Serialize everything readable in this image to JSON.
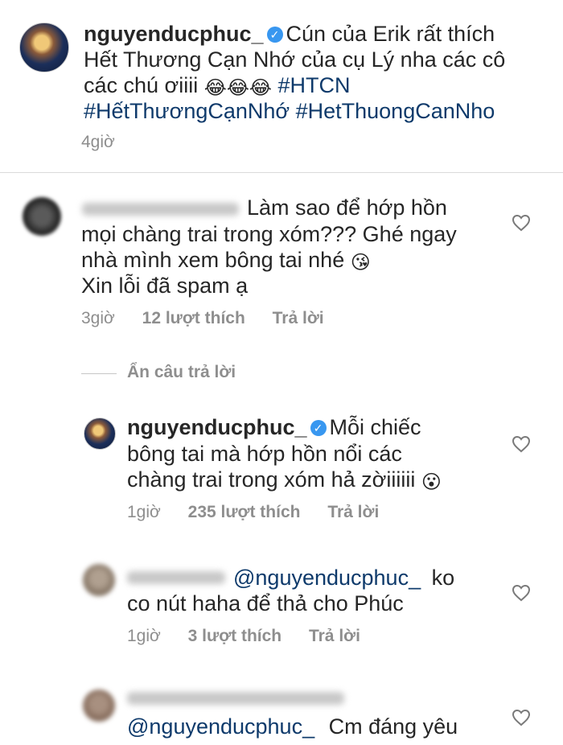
{
  "caption": {
    "username": "nguyenducphuc_",
    "verified_icon": "verified-badge-icon",
    "line1": "Cún của Erik rất thích",
    "line2": "Hết Thương Cạn Nhớ của cụ Lý nha các cô",
    "line3_text": "các chú ơiiii",
    "line3_emojis": "😂😂😂",
    "line3_tag": "#HTCN",
    "line4_tags": "#HếtThươngCạnNhớ #HetThuongCanNho",
    "time": "4giờ"
  },
  "comment1": {
    "line1": "Làm sao để hớp hồn",
    "line2": "mọi chàng trai trong xóm??? Ghé ngay",
    "line3_text": "nhà mình xem bông tai nhé",
    "line3_emoji": "😘",
    "line4": "Xin lỗi đã spam ạ",
    "time": "3giờ",
    "likes": "12 lượt thích",
    "reply": "Trả lời",
    "hide_replies": "Ẩn câu trả lời"
  },
  "reply1": {
    "username": "nguyenducphuc_",
    "line1": "Mỗi chiếc",
    "line2": "bông tai mà hớp hồn nổi các",
    "line3_text": "chàng trai trong xóm hả zờiiiiii",
    "line3_emoji": "😮",
    "time": "1giờ",
    "likes": "235 lượt thích",
    "reply": "Trả lời"
  },
  "reply2": {
    "mention": "@nguyenducphuc_",
    "line1_rest": "ko",
    "line2": "co nút haha để thả cho Phúc",
    "time": "1giờ",
    "likes": "3 lượt thích",
    "reply": "Trả lời"
  },
  "reply3": {
    "mention": "@nguyenducphuc_",
    "rest": "Cm đáng yêu"
  },
  "icons": {
    "heart": "heart-outline-icon"
  }
}
